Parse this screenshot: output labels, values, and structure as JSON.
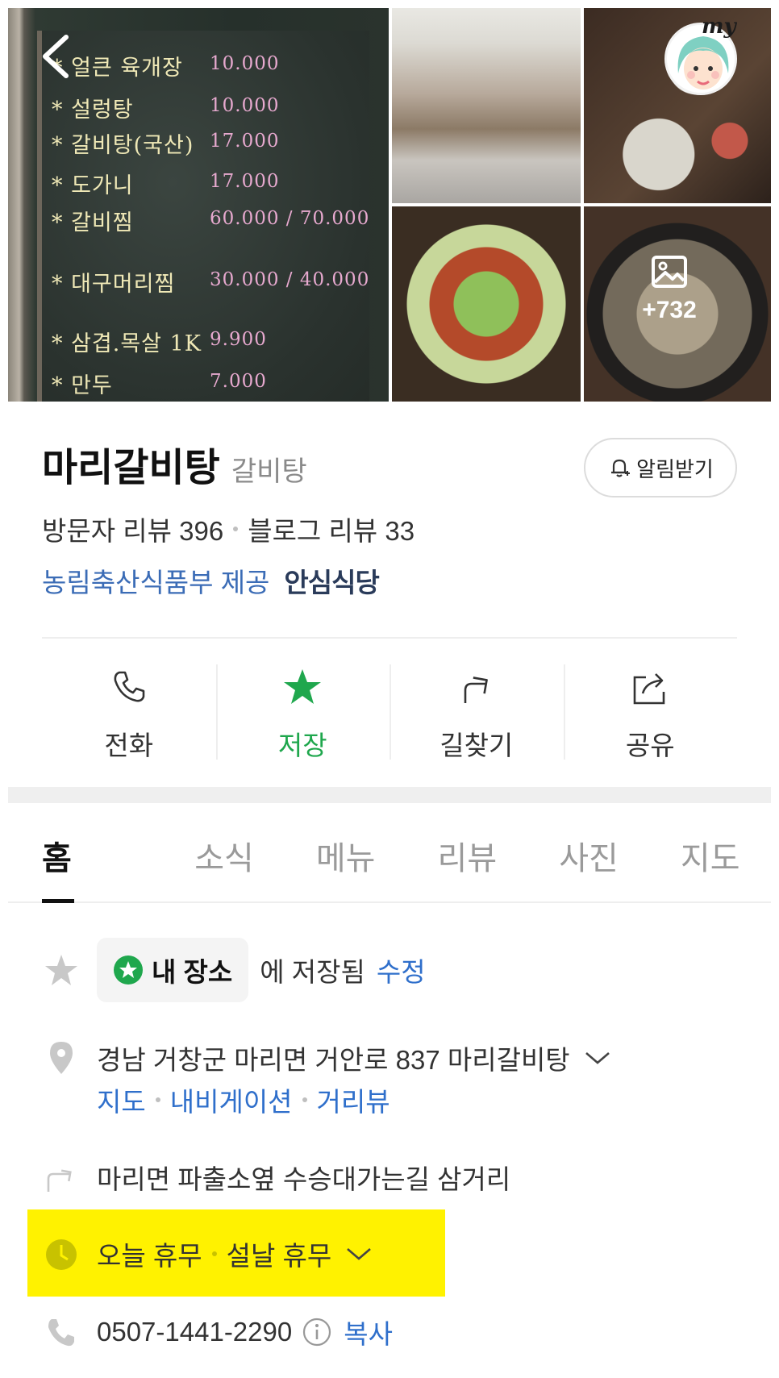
{
  "gallery": {
    "menu_board": [
      {
        "item": "* 얼큰 육개장",
        "price": "10.000"
      },
      {
        "item": "* 설렁탕",
        "price": "10.000"
      },
      {
        "item": "* 갈비탕(국산)",
        "price": "17.000"
      },
      {
        "item": "* 도가니",
        "price": "17.000"
      },
      {
        "item": "* 갈비찜",
        "price": "60.000 / 70.000"
      },
      {
        "item": "* 대구머리찜",
        "price": "30.000 / 40.000"
      },
      {
        "item": "* 삼겹.목살 1K",
        "price": "9.900"
      },
      {
        "item": "* 만두",
        "price": "7.000"
      }
    ],
    "more_photos_count": "+732",
    "my_badge": "my"
  },
  "place": {
    "name": "마리갈비탕",
    "category": "갈비탕",
    "notify_label": "알림받기",
    "visitor_reviews": "방문자 리뷰 396",
    "blog_reviews": "블로그 리뷰 33",
    "provider": "농림축산식품부 제공",
    "safe_badge": "안심식당"
  },
  "actions": [
    {
      "label": "전화",
      "icon": "phone-icon"
    },
    {
      "label": "저장",
      "icon": "star-icon"
    },
    {
      "label": "길찾기",
      "icon": "directions-icon"
    },
    {
      "label": "공유",
      "icon": "share-icon"
    }
  ],
  "tabs": [
    "홈",
    "소식",
    "메뉴",
    "리뷰",
    "사진",
    "지도"
  ],
  "details": {
    "saved_chip": "내 장소",
    "saved_text": "에 저장됨",
    "edit_label": "수정",
    "address": "경남 거창군 마리면 거안로 837 마리갈비탕",
    "addr_links": [
      "지도",
      "내비게이션",
      "거리뷰"
    ],
    "directions": "마리면 파출소옆 수승대가는길 삼거리",
    "hours_today": "오늘 휴무",
    "hours_holiday": "설날 휴무",
    "phone": "0507-1441-2290",
    "copy_label": "복사"
  },
  "colors": {
    "accent_green": "#1fa74d",
    "link_blue": "#2f6fcb",
    "highlight_yellow": "#fff200"
  }
}
